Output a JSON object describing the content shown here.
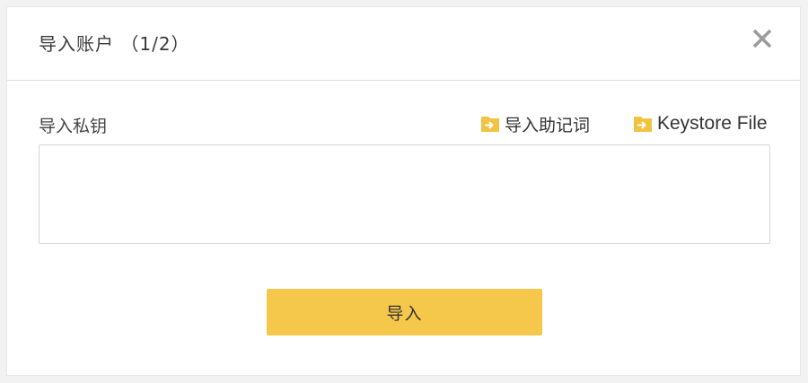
{
  "dialog": {
    "title": "导入账户 （1/2）",
    "close_icon": "close-icon"
  },
  "private_key": {
    "label": "导入私钥",
    "input_value": "",
    "input_placeholder": ""
  },
  "links": {
    "mnemonic": {
      "label": "导入助记词",
      "icon": "import-arrow-icon"
    },
    "keystore": {
      "label": "Keystore File",
      "icon": "import-arrow-icon"
    }
  },
  "actions": {
    "import_label": "导入"
  },
  "colors": {
    "accent": "#f5c84c",
    "icon_yellow": "#f2c341",
    "close_gray": "#9a9a9a"
  }
}
